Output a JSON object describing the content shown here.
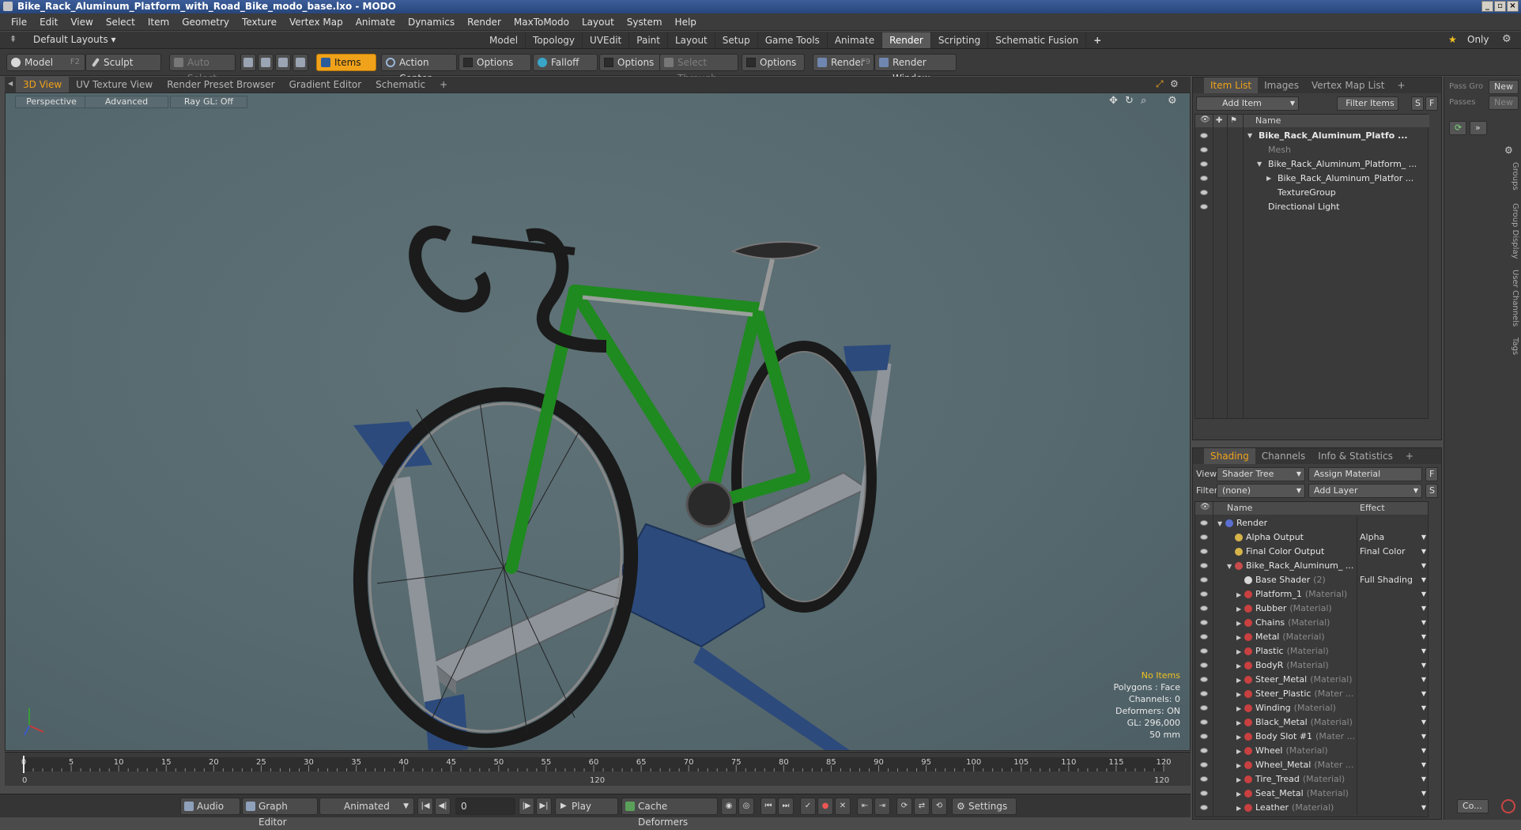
{
  "window": {
    "title": "Bike_Rack_Aluminum_Platform_with_Road_Bike_modo_base.lxo - MODO",
    "buttons": [
      "_",
      "▫",
      "×"
    ]
  },
  "menu": [
    "File",
    "Edit",
    "View",
    "Select",
    "Item",
    "Geometry",
    "Texture",
    "Vertex Map",
    "Animate",
    "Dynamics",
    "Render",
    "MaxToModo",
    "Layout",
    "System",
    "Help"
  ],
  "layout": {
    "preset_label": "Default Layouts",
    "tabs": [
      "Model",
      "Topology",
      "UVEdit",
      "Paint",
      "Layout",
      "Setup",
      "Game Tools",
      "Animate",
      "Render",
      "Scripting",
      "Schematic Fusion",
      "+"
    ],
    "active_tab": "Render",
    "only_label": "Only"
  },
  "toolbar": {
    "model": "Model",
    "model_key": "F2",
    "sculpt": "Sculpt",
    "auto_select": "Auto Select",
    "items": "Items",
    "action_center": "Action Center",
    "options1": "Options",
    "falloff": "Falloff",
    "options2": "Options",
    "select_through": "Select Through",
    "options3": "Options",
    "render": "Render",
    "render_key": "F9",
    "render_window": "Render Window"
  },
  "viewport": {
    "tabs": [
      "3D View",
      "UV Texture View",
      "Render Preset Browser",
      "Gradient Editor",
      "Schematic",
      "+"
    ],
    "active_tab": "3D View",
    "perspective": "Perspective",
    "advanced": "Advanced",
    "raygl": "Ray GL: Off",
    "stats": {
      "no_items": "No Items",
      "polygons": "Polygons : Face",
      "channels": "Channels: 0",
      "deformers": "Deformers: ON",
      "gl": "GL: 296,000",
      "size": "50 mm"
    }
  },
  "timeline": {
    "ticks": [
      0,
      5,
      10,
      15,
      20,
      25,
      30,
      35,
      40,
      45,
      50,
      55,
      60,
      65,
      70,
      75,
      80,
      85,
      90,
      95,
      100,
      105,
      110,
      115,
      120
    ],
    "start": "0",
    "mid": "120",
    "end": "120"
  },
  "bottom": {
    "audio": "Audio",
    "graph_editor": "Graph Editor",
    "animated": "Animated",
    "frame": "0",
    "play": "Play",
    "cache_deformers": "Cache Deformers",
    "settings": "Settings"
  },
  "item_list": {
    "tabs": [
      "Item List",
      "Images",
      "Vertex Map List",
      "+"
    ],
    "active_tab": "Item List",
    "add_item": "Add Item",
    "filter_items": "Filter Items",
    "s": "S",
    "f": "F",
    "col_name": "Name",
    "rows": [
      {
        "label": "Bike_Rack_Aluminum_Platfo ...",
        "indent": 0,
        "bold": true,
        "sub": ""
      },
      {
        "label": "Mesh",
        "indent": 1,
        "bold": false,
        "sub": "dim"
      },
      {
        "label": "Bike_Rack_Aluminum_Platform_ ...",
        "indent": 1,
        "bold": false,
        "sub": ""
      },
      {
        "label": "Bike_Rack_Aluminum_Platfor ...",
        "indent": 2,
        "bold": false,
        "sub": ""
      },
      {
        "label": "TextureGroup",
        "indent": 2,
        "bold": false,
        "sub": ""
      },
      {
        "label": "Directional Light",
        "indent": 1,
        "bold": false,
        "sub": ""
      }
    ]
  },
  "shading": {
    "tabs": [
      "Shading",
      "Channels",
      "Info & Statistics",
      "+"
    ],
    "active_tab": "Shading",
    "view_label": "View",
    "view_value": "Shader Tree",
    "assign_material": "Assign Material",
    "filter_label": "Filter",
    "filter_value": "(none)",
    "add_layer": "Add Layer",
    "f": "F",
    "s": "S",
    "col_name": "Name",
    "col_effect": "Effect",
    "rows": [
      {
        "label": "Render",
        "sub": "",
        "effect": "",
        "color": "#5a6fd0",
        "indent": 0
      },
      {
        "label": "Alpha Output",
        "sub": "",
        "effect": "Alpha",
        "color": "#d6b44a",
        "indent": 1
      },
      {
        "label": "Final Color Output",
        "sub": "",
        "effect": "Final Color",
        "color": "#d6b44a",
        "indent": 1
      },
      {
        "label": "Bike_Rack_Aluminum_ ...",
        "sub": "",
        "effect": "",
        "color": "#c94b4b",
        "indent": 1
      },
      {
        "label": "Base Shader",
        "sub": "(2)",
        "effect": "Full Shading",
        "color": "#d8d8d8",
        "indent": 2
      },
      {
        "label": "Platform_1",
        "sub": "(Material)",
        "effect": "",
        "color": "#c94040",
        "indent": 2
      },
      {
        "label": "Rubber",
        "sub": "(Material)",
        "effect": "",
        "color": "#c94040",
        "indent": 2
      },
      {
        "label": "Chains",
        "sub": "(Material)",
        "effect": "",
        "color": "#c94040",
        "indent": 2
      },
      {
        "label": "Metal",
        "sub": "(Material)",
        "effect": "",
        "color": "#c94040",
        "indent": 2
      },
      {
        "label": "Plastic",
        "sub": "(Material)",
        "effect": "",
        "color": "#c94040",
        "indent": 2
      },
      {
        "label": "BodyR",
        "sub": "(Material)",
        "effect": "",
        "color": "#c94040",
        "indent": 2
      },
      {
        "label": "Steer_Metal",
        "sub": "(Material)",
        "effect": "",
        "color": "#c94040",
        "indent": 2
      },
      {
        "label": "Steer_Plastic",
        "sub": "(Mater ...",
        "effect": "",
        "color": "#c94040",
        "indent": 2
      },
      {
        "label": "Winding",
        "sub": "(Material)",
        "effect": "",
        "color": "#c94040",
        "indent": 2
      },
      {
        "label": "Black_Metal",
        "sub": "(Material)",
        "effect": "",
        "color": "#c94040",
        "indent": 2
      },
      {
        "label": "Body Slot #1",
        "sub": "(Mater ...",
        "effect": "",
        "color": "#c94040",
        "indent": 2
      },
      {
        "label": "Wheel",
        "sub": "(Material)",
        "effect": "",
        "color": "#c94040",
        "indent": 2
      },
      {
        "label": "Wheel_Metal",
        "sub": "(Mater ...",
        "effect": "",
        "color": "#c94040",
        "indent": 2
      },
      {
        "label": "Tire_Tread",
        "sub": "(Material)",
        "effect": "",
        "color": "#c94040",
        "indent": 2
      },
      {
        "label": "Seat_Metal",
        "sub": "(Material)",
        "effect": "",
        "color": "#c94040",
        "indent": 2
      },
      {
        "label": "Leather",
        "sub": "(Material)",
        "effect": "",
        "color": "#c94040",
        "indent": 2
      }
    ]
  },
  "far_right": {
    "pass_group": "Pass Gro",
    "new1": "New",
    "passes": "Passes",
    "new2": "New",
    "side_tabs": [
      "Groups",
      "Group Display",
      "User Channels",
      "Tags"
    ],
    "co": "Co..."
  },
  "colors": {
    "accent": "#f0a21a",
    "viewport_bg": "#566a70",
    "bike_frame": "#1f8a1f",
    "rack": "#2c4a7c"
  }
}
